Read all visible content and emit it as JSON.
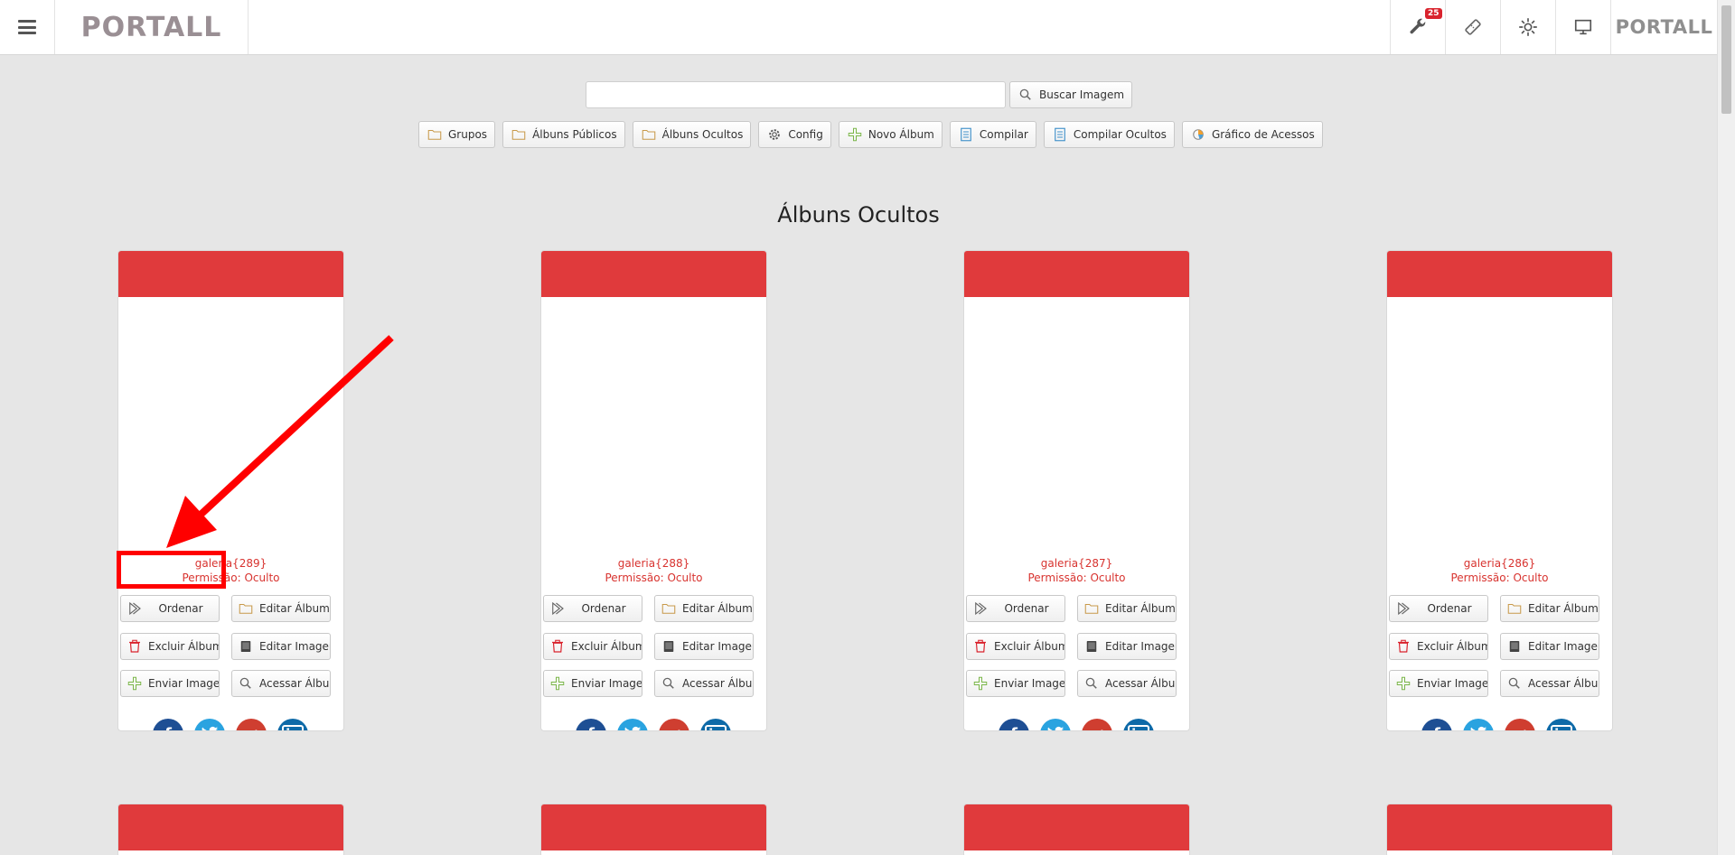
{
  "header": {
    "logo": "PORTALL",
    "logo_right": "PORTALL",
    "notification_count": "25"
  },
  "search": {
    "placeholder": "",
    "value": "",
    "button_label": "Buscar Imagem"
  },
  "toolbar": {
    "grupos": "Grupos",
    "albuns_publicos": "Álbuns Públicos",
    "albuns_ocultos": "Álbuns Ocultos",
    "config": "Config",
    "novo_album": "Novo Álbum",
    "compilar": "Compilar",
    "compilar_ocultos": "Compilar Ocultos",
    "grafico": "Gráfico de Acessos"
  },
  "page_title": "Álbuns Ocultos",
  "card_buttons": {
    "ordenar": "Ordenar",
    "editar_album": "Editar Álbum",
    "excluir_album": "Excluir Álbum",
    "editar_imagens": "Editar Imagens",
    "enviar_imagens": "Enviar Imagens",
    "acessar_album": "Acessar Álbum"
  },
  "albums": [
    {
      "name": "galeria{289}",
      "permission": "Permissão: Oculto"
    },
    {
      "name": "galeria{288}",
      "permission": "Permissão: Oculto"
    },
    {
      "name": "galeria{287}",
      "permission": "Permissão: Oculto"
    },
    {
      "name": "galeria{286}",
      "permission": "Permissão: Oculto"
    }
  ],
  "social": {
    "facebook": "f",
    "googleplus": "g+",
    "linkedin": "in"
  },
  "colors": {
    "card_header": "#e03a3c",
    "accent_red": "#d8332f",
    "annotation": "#ff0000"
  }
}
